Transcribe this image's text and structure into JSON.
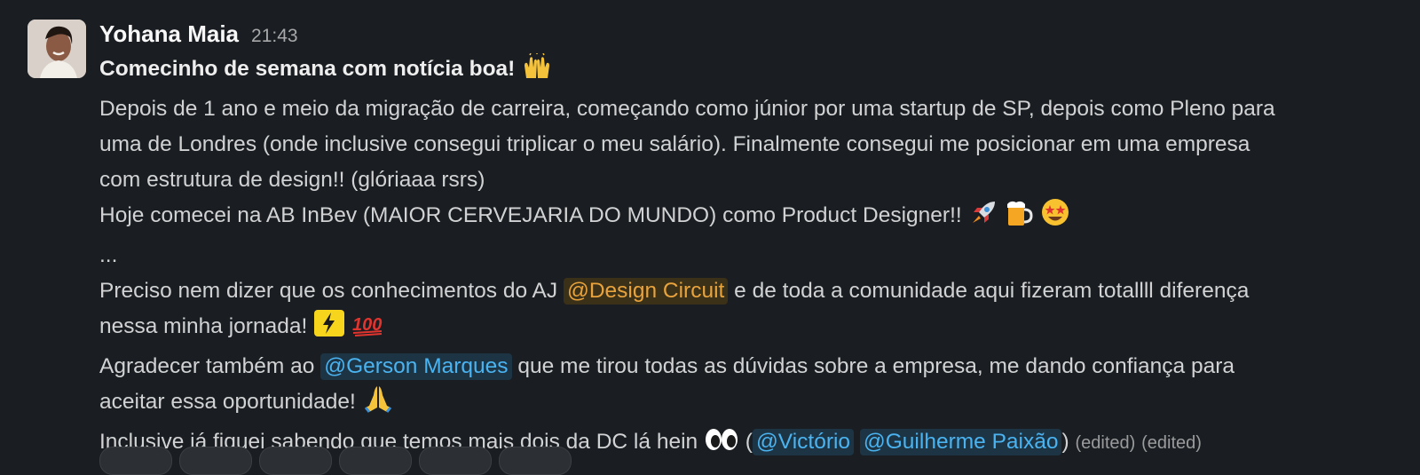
{
  "message": {
    "author": "Yohana Maia",
    "timestamp": "21:43",
    "headline": "Comecinho de semana com notícia boa!",
    "para1_line1": "Depois de 1 ano e meio da migração de carreira, começando como júnior por uma startup de SP, depois como Pleno para",
    "para1_line2": "uma de Londres (onde inclusive consegui triplicar o meu salário). Finalmente consegui me posicionar em uma empresa",
    "para1_line3": "com estrutura de design!! (glóriaaa rsrs)",
    "para2": "Hoje comecei na AB InBev (MAIOR CERVEJARIA DO MUNDO) como Product Designer!!",
    "ellipsis": "...",
    "para3_before": "Preciso nem dizer que os conhecimentos do AJ",
    "mention_group": "@Design Circuit",
    "para3_after": "e de toda a comunidade aqui fizeram totallll diferença",
    "para3_line2": "nessa minha jornada!",
    "para4_before": "Agradecer também ao",
    "mention_gerson": "@Gerson Marques",
    "para4_after": "que me tirou todas as dúvidas sobre a empresa, me dando confiança para",
    "para4_line2": "aceitar essa oportunidade!",
    "para5_before": "Inclusive já fiquei sabendo que temos mais dois da DC lá hein",
    "paren_open": "(",
    "mention_victorio": "@Victório",
    "mention_guilherme": "@Guilherme Paixão",
    "paren_close": ")",
    "edited_1": "(edited)",
    "edited_2": "(edited)"
  },
  "icons": {
    "avatar": "user-avatar-photo",
    "raised_hands": "raised-hands-emoji",
    "rocket": "rocket-emoji",
    "beer": "beer-mug-emoji",
    "star_struck": "star-struck-emoji",
    "lightning": "lightning-emoji",
    "hundred": "hundred-points-emoji",
    "pray": "folded-hands-emoji",
    "eyes": "eyes-emoji"
  },
  "colors": {
    "background": "#1a1d21",
    "text": "#d1d2d3",
    "group_mention": "#e8a33d",
    "user_mention": "#4ab3f0"
  }
}
